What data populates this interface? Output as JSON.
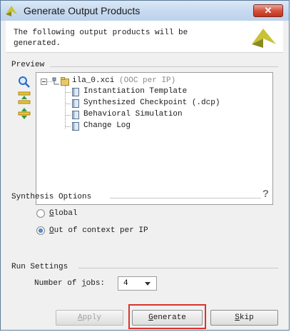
{
  "window": {
    "title": "Generate Output Products",
    "close_label": "✕"
  },
  "header": {
    "description_line1": "The following output products will be",
    "description_line2": "generated."
  },
  "preview": {
    "label": "Preview",
    "tools": [
      "search-icon",
      "collapse-all-icon",
      "expand-all-icon"
    ],
    "root": {
      "name": "ila_0.xci",
      "note": "(OOC per IP)"
    },
    "children": [
      "Instantiation Template",
      "Synthesized Checkpoint (.dcp)",
      "Behavioral Simulation",
      "Change Log"
    ]
  },
  "synthesis": {
    "label": "Synthesis Options",
    "help": "?",
    "global": {
      "mnemonic": "G",
      "rest": "lobal",
      "checked": false
    },
    "ooc": {
      "mnemonic": "O",
      "rest": "ut of context per IP",
      "checked": true
    }
  },
  "run": {
    "label": "Run Settings",
    "jobs_label_pre": "Number of ",
    "jobs_mnemonic": "j",
    "jobs_label_post": "obs:",
    "jobs_value": "4"
  },
  "buttons": {
    "apply": {
      "mnemonic": "A",
      "rest": "pply"
    },
    "generate": {
      "mnemonic": "G",
      "rest": "enerate"
    },
    "skip": {
      "mnemonic": "S",
      "rest": "kip"
    }
  },
  "colors": {
    "accent": "#1f5fb8",
    "highlight": "#d9342b",
    "logo": "#c8c236"
  }
}
